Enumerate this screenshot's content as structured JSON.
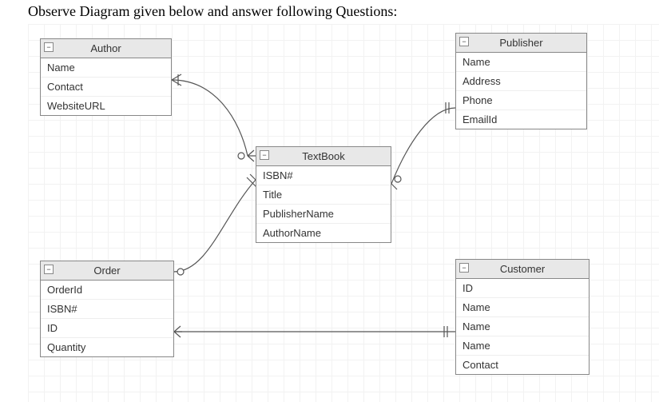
{
  "question_text": "Observe Diagram given below and answer following Questions:",
  "entities": {
    "author": {
      "title": "Author",
      "attrs": [
        "Name",
        "Contact",
        "WebsiteURL"
      ]
    },
    "publisher": {
      "title": "Publisher",
      "attrs": [
        "Name",
        "Address",
        "Phone",
        "EmailId"
      ]
    },
    "textbook": {
      "title": "TextBook",
      "attrs": [
        "ISBN#",
        "Title",
        "PublisherName",
        "AuthorName"
      ]
    },
    "order": {
      "title": "Order",
      "attrs": [
        "OrderId",
        "ISBN#",
        "ID",
        "Quantity"
      ]
    },
    "customer": {
      "title": "Customer",
      "attrs": [
        "ID",
        "Name",
        "Name",
        "Name",
        "Contact"
      ]
    }
  },
  "chart_data": {
    "type": "er-diagram",
    "entities": [
      {
        "name": "Author",
        "attributes": [
          "Name",
          "Contact",
          "WebsiteURL"
        ]
      },
      {
        "name": "Publisher",
        "attributes": [
          "Name",
          "Address",
          "Phone",
          "EmailId"
        ]
      },
      {
        "name": "TextBook",
        "attributes": [
          "ISBN#",
          "Title",
          "PublisherName",
          "AuthorName"
        ]
      },
      {
        "name": "Order",
        "attributes": [
          "OrderId",
          "ISBN#",
          "ID",
          "Quantity"
        ]
      },
      {
        "name": "Customer",
        "attributes": [
          "ID",
          "Name",
          "Name",
          "Name",
          "Contact"
        ]
      }
    ],
    "relationships": [
      {
        "from": "Author",
        "to": "TextBook",
        "from_card": "one-mandatory",
        "to_card": "many-optional"
      },
      {
        "from": "Publisher",
        "to": "TextBook",
        "from_card": "one-mandatory",
        "to_card": "many-optional"
      },
      {
        "from": "Order",
        "to": "TextBook",
        "from_card": "many-optional",
        "to_card": "one-mandatory"
      },
      {
        "from": "Order",
        "to": "Customer",
        "from_card": "many-optional",
        "to_card": "one-mandatory"
      }
    ]
  }
}
